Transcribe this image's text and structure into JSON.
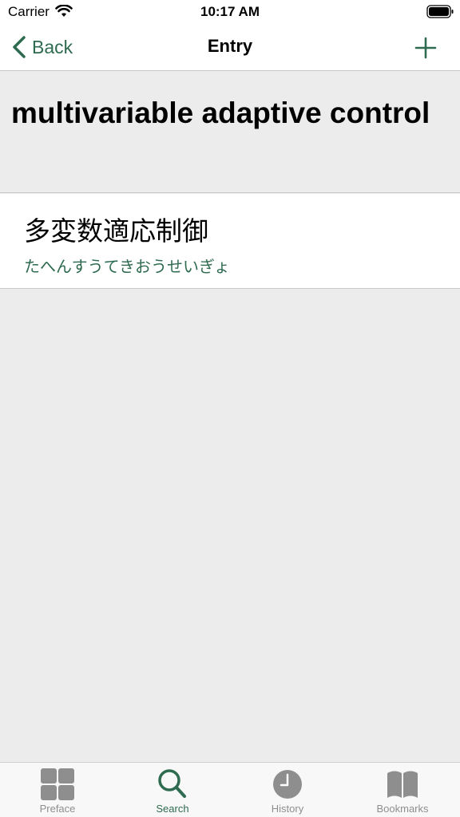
{
  "status_bar": {
    "carrier": "Carrier",
    "time": "10:17 AM"
  },
  "nav": {
    "back_label": "Back",
    "title": "Entry"
  },
  "entry": {
    "term": "multivariable adaptive control"
  },
  "result": {
    "kanji": "多変数適応制御",
    "reading": "たへんすうてきおうせいぎょ"
  },
  "tabs": [
    {
      "label": "Preface",
      "icon": "grid-icon",
      "active": false
    },
    {
      "label": "Search",
      "icon": "search-icon",
      "active": true
    },
    {
      "label": "History",
      "icon": "clock-icon",
      "active": false
    },
    {
      "label": "Bookmarks",
      "icon": "book-icon",
      "active": false
    }
  ],
  "colors": {
    "accent": "#2e6b50",
    "inactive": "#8e8e8e",
    "background": "#ececec"
  }
}
